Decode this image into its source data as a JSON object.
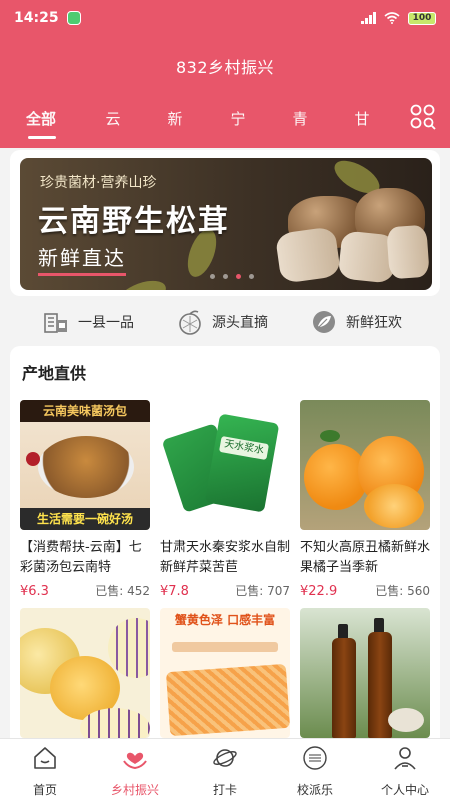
{
  "status": {
    "time": "14:25",
    "battery": "100"
  },
  "header": {
    "title": "832乡村振兴",
    "tabs": [
      {
        "label": "全部",
        "active": true
      },
      {
        "label": "云"
      },
      {
        "label": "新"
      },
      {
        "label": "宁"
      },
      {
        "label": "青"
      },
      {
        "label": "甘"
      }
    ],
    "grid_icon": "category-grid-icon"
  },
  "banner": {
    "subtitle": "珍贵菌材·营养山珍",
    "title": "云南野生松茸",
    "tag": "新鲜直达",
    "dots": 4,
    "active_dot": 2
  },
  "features": [
    {
      "label": "一县一品",
      "icon": "county-building-icon"
    },
    {
      "label": "源头直摘",
      "icon": "fruit-icon"
    },
    {
      "label": "新鲜狂欢",
      "icon": "fresh-leaf-icon"
    }
  ],
  "section": {
    "title": "产地直供",
    "products": [
      {
        "name": "【消费帮扶-云南】七彩菌汤包云南特",
        "price": "¥6.3",
        "sold": "已售: 452",
        "img_top": "云南美味菌汤包",
        "img_bottom": "生活需要一碗好汤"
      },
      {
        "name": "甘肃天水秦安浆水自制新鲜芹菜苦苣",
        "price": "¥7.8",
        "sold": "已售: 707",
        "img_label": "天水浆水"
      },
      {
        "name": "不知火高原丑橘新鲜水果橘子当季新",
        "price": "¥22.9",
        "sold": "已售: 560"
      },
      {
        "name": "",
        "price": "",
        "sold": ""
      },
      {
        "name": "",
        "price": "",
        "sold": "",
        "img_top": "蟹黄色泽 口感丰富"
      },
      {
        "name": "",
        "price": "",
        "sold": ""
      }
    ]
  },
  "tabbar": [
    {
      "label": "首页",
      "icon": "home-icon"
    },
    {
      "label": "乡村振兴",
      "icon": "heart-hands-icon",
      "active": true
    },
    {
      "label": "打卡",
      "icon": "planet-icon"
    },
    {
      "label": "校派乐",
      "icon": "school-badge-icon"
    },
    {
      "label": "个人中心",
      "icon": "user-icon"
    }
  ],
  "colors": {
    "brand": "#e8566a",
    "price": "#e0314f"
  }
}
